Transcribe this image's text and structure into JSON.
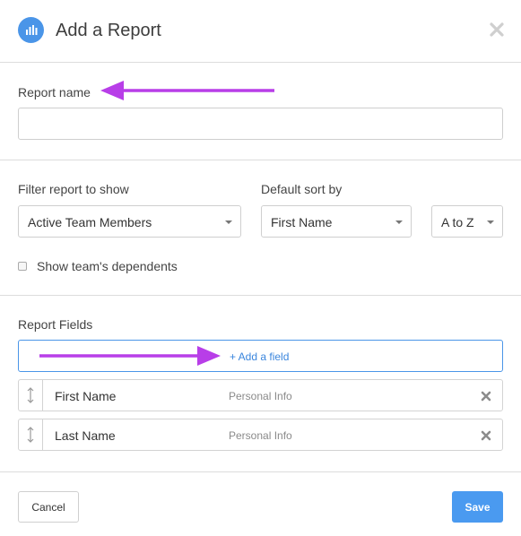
{
  "header": {
    "title": "Add a Report",
    "icon": "bar-chart-icon",
    "close_icon": "close-icon"
  },
  "report_name": {
    "label": "Report name",
    "value": "",
    "placeholder": ""
  },
  "filter": {
    "label": "Filter report to show",
    "selected": "Active Team Members"
  },
  "sort": {
    "label": "Default sort by",
    "field_selected": "First Name",
    "order_selected": "A to Z"
  },
  "dependents": {
    "label": "Show team's dependents",
    "checked": false
  },
  "report_fields": {
    "label": "Report Fields",
    "add_field_label": "+ Add a field",
    "items": [
      {
        "name": "First Name",
        "category": "Personal Info"
      },
      {
        "name": "Last Name",
        "category": "Personal Info"
      }
    ]
  },
  "footer": {
    "cancel_label": "Cancel",
    "save_label": "Save"
  },
  "colors": {
    "accent": "#4a95e8",
    "save_button": "#4a9af0",
    "annotation_arrow": "#b83ee8"
  }
}
